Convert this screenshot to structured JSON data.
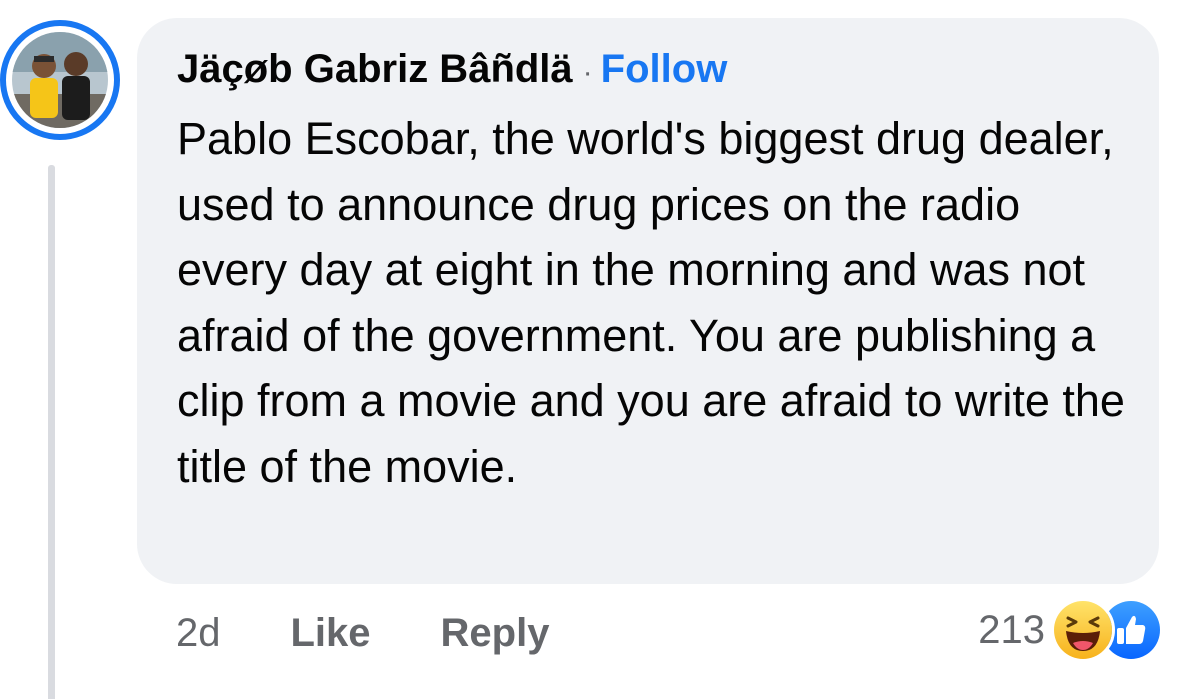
{
  "comment": {
    "author": "Jäçøb Gabriz Bâñdlä",
    "separator": "·",
    "follow_label": "Follow",
    "text": "Pablo Escobar, the world's biggest drug dealer, used to announce drug prices on the radio every day at eight in the morning and was not afraid of the government. You are publishing a clip from a movie and you are afraid to write the title of the movie.",
    "time": "2d",
    "like_label": "Like",
    "reply_label": "Reply",
    "reaction_count": "213",
    "reactions": [
      "haha-icon",
      "like-icon"
    ]
  },
  "colors": {
    "accent": "#1877f2",
    "bubble": "#f0f2f5",
    "muted": "#65676b",
    "text": "#050505",
    "thread_line": "#d9dbe0"
  }
}
